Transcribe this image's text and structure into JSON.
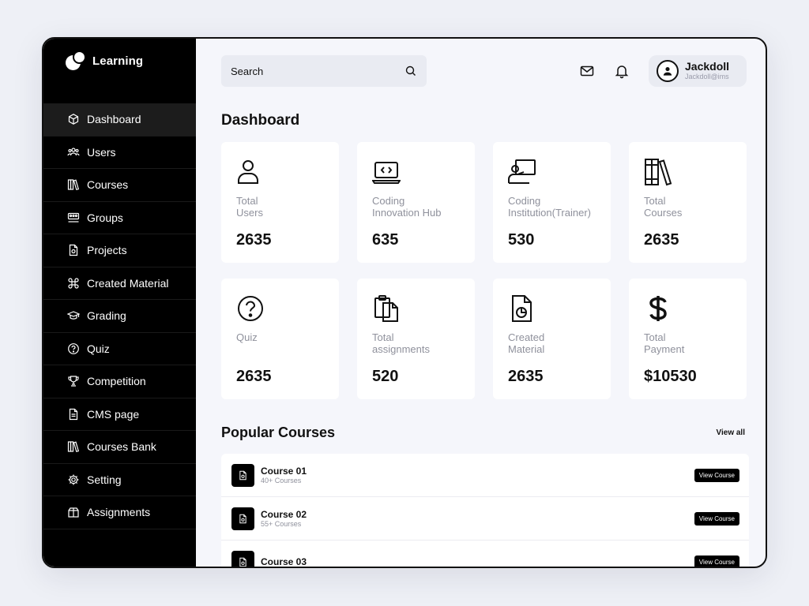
{
  "brand": {
    "name": "Learning"
  },
  "sidebar": {
    "items": [
      {
        "label": "Dashboard",
        "icon": "cube-icon",
        "active": true
      },
      {
        "label": "Users",
        "icon": "users-icon"
      },
      {
        "label": "Courses",
        "icon": "books-icon"
      },
      {
        "label": "Groups",
        "icon": "groups-icon"
      },
      {
        "label": "Projects",
        "icon": "file-icon"
      },
      {
        "label": "Created Material",
        "icon": "command-icon"
      },
      {
        "label": "Grading",
        "icon": "graduation-cap-icon"
      },
      {
        "label": "Quiz",
        "icon": "question-icon"
      },
      {
        "label": "Competition",
        "icon": "trophy-icon"
      },
      {
        "label": "CMS page",
        "icon": "document-icon"
      },
      {
        "label": "Courses Bank",
        "icon": "books-icon"
      },
      {
        "label": "Setting",
        "icon": "gear-icon"
      },
      {
        "label": "Assignments",
        "icon": "box-icon"
      }
    ]
  },
  "header": {
    "search_placeholder": "Search",
    "user": {
      "name": "Jackdoll",
      "email": "Jackdoll@ims"
    }
  },
  "main": {
    "title": "Dashboard",
    "stats": [
      {
        "label": "Total\nUsers",
        "value": "2635",
        "icon": "user-icon"
      },
      {
        "label": "Coding\nInnovation Hub",
        "value": "635",
        "icon": "laptop-code-icon"
      },
      {
        "label": "Coding\nInstitution(Trainer)",
        "value": "530",
        "icon": "trainer-icon"
      },
      {
        "label": "Total\nCourses",
        "value": "2635",
        "icon": "books-icon"
      },
      {
        "label": "Quiz",
        "value": "2635",
        "icon": "question-icon"
      },
      {
        "label": "Total\nassignments",
        "value": "520",
        "icon": "clipboard-icon"
      },
      {
        "label": "Created\nMaterial",
        "value": "2635",
        "icon": "file-chart-icon"
      },
      {
        "label": "Total\nPayment",
        "value": "$10530",
        "icon": "dollar-icon"
      }
    ],
    "popular": {
      "title": "Popular Courses",
      "view_all": "View all",
      "courses": [
        {
          "title": "Course 01",
          "sub": "40+ Courses",
          "button": "View Course"
        },
        {
          "title": "Course 02",
          "sub": "55+ Courses",
          "button": "View Course"
        },
        {
          "title": "Course 03",
          "sub": "",
          "button": "View Course"
        }
      ]
    }
  },
  "colors": {
    "sidebar_bg": "#000000",
    "main_bg": "#f5f6fb",
    "card_bg": "#ffffff",
    "muted": "#8f919c"
  }
}
